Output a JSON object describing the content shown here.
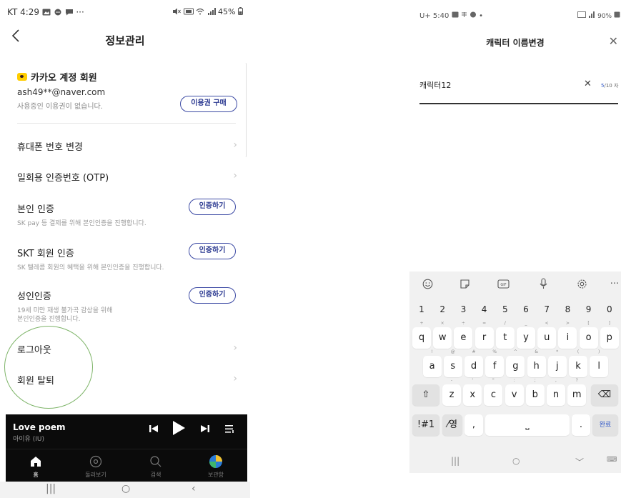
{
  "left": {
    "status_bar": {
      "left": "KT 4:29",
      "dots": "···",
      "right": "45%"
    },
    "header": {
      "back_icon": "chevron-left-icon",
      "title": "정보관리"
    },
    "account": {
      "badge_icon": "kakao-talk-icon",
      "name": "카카오 계정 회원",
      "email": "ash49**@naver.com",
      "note": "사용중인 이용권이 없습니다.",
      "buy_label": "이용권 구매"
    },
    "rows": [
      {
        "title": "휴대폰 번호 변경",
        "chevron": "›"
      },
      {
        "title": "일회용 인증번호 (OTP)",
        "chevron": "›"
      },
      {
        "title": "본인 인증",
        "sub": "SK pay 등 결제를 위해 본인인증을 진행합니다.",
        "button": "인증하기"
      },
      {
        "title": "SKT 회원 인증",
        "sub": "SK 텔레콤 회원의 혜택을 위해 본인인증을 진행합니다.",
        "button": "인증하기"
      },
      {
        "title": "성인인증",
        "sub": "19세 미만 재생 불가곡 감상을 위해",
        "sub2": "본인인증을 진행합니다.",
        "button": "인증하기"
      },
      {
        "title": "로그아웃",
        "chevron": "›"
      },
      {
        "title": "회원 탈퇴",
        "chevron": "›"
      }
    ],
    "player": {
      "title": "Love poem",
      "artist": "아이유 (IU)"
    },
    "tabs": [
      {
        "label": "홈",
        "icon": "home-icon",
        "active": true
      },
      {
        "label": "둘러보기",
        "icon": "disc-icon",
        "active": false
      },
      {
        "label": "검색",
        "icon": "search-icon",
        "active": false
      },
      {
        "label": "보관함",
        "icon": "library-icon",
        "active": false
      }
    ],
    "nav": {
      "recents": "|||",
      "home": "○",
      "back": "‹"
    }
  },
  "right": {
    "status_bar": {
      "left": "U+ 5:40",
      "dot": "•",
      "right": "90%"
    },
    "header": {
      "title": "캐릭터 이름변경",
      "close": "✕"
    },
    "input": {
      "value": "캐릭터12",
      "clear": "✕",
      "count": "5",
      "count_max": "/10 자"
    },
    "keyboard": {
      "toolbar_icons": [
        "emoji-icon",
        "sticker-icon",
        "gif-icon",
        "microphone-icon",
        "settings-icon",
        "more-icon"
      ],
      "gif_label": "GIF",
      "more": "···",
      "numbers": [
        "1",
        "2",
        "3",
        "4",
        "5",
        "6",
        "7",
        "8",
        "9",
        "0"
      ],
      "row1": [
        {
          "k": "q",
          "h": "+"
        },
        {
          "k": "w",
          "h": "×"
        },
        {
          "k": "e",
          "h": "÷"
        },
        {
          "k": "r",
          "h": "="
        },
        {
          "k": "t",
          "h": "/"
        },
        {
          "k": "y",
          "h": "_"
        },
        {
          "k": "u",
          "h": "<"
        },
        {
          "k": "i",
          "h": ">"
        },
        {
          "k": "o",
          "h": "["
        },
        {
          "k": "p",
          "h": "]"
        }
      ],
      "row2": [
        {
          "k": "a",
          "h": "!"
        },
        {
          "k": "s",
          "h": "@"
        },
        {
          "k": "d",
          "h": "#"
        },
        {
          "k": "f",
          "h": "%"
        },
        {
          "k": "g",
          "h": "^"
        },
        {
          "k": "h",
          "h": "&"
        },
        {
          "k": "j",
          "h": "*"
        },
        {
          "k": "k",
          "h": "("
        },
        {
          "k": "l",
          "h": ")"
        }
      ],
      "row3": [
        {
          "k": "z",
          "h": "-"
        },
        {
          "k": "x",
          "h": "'"
        },
        {
          "k": "c",
          "h": "\""
        },
        {
          "k": "v",
          "h": ":"
        },
        {
          "k": "b",
          "h": ";"
        },
        {
          "k": "n",
          "h": ","
        },
        {
          "k": "m",
          "h": "?"
        }
      ],
      "shift": "⇧",
      "backspace": "⌫",
      "sym": "!#1",
      "lang": "⁄영",
      "comma": ",",
      "space": "⎵",
      "period": ".",
      "done": "완료"
    },
    "nav": {
      "recents": "|||",
      "home": "○",
      "down": "﹀",
      "kb": "⌨"
    }
  }
}
